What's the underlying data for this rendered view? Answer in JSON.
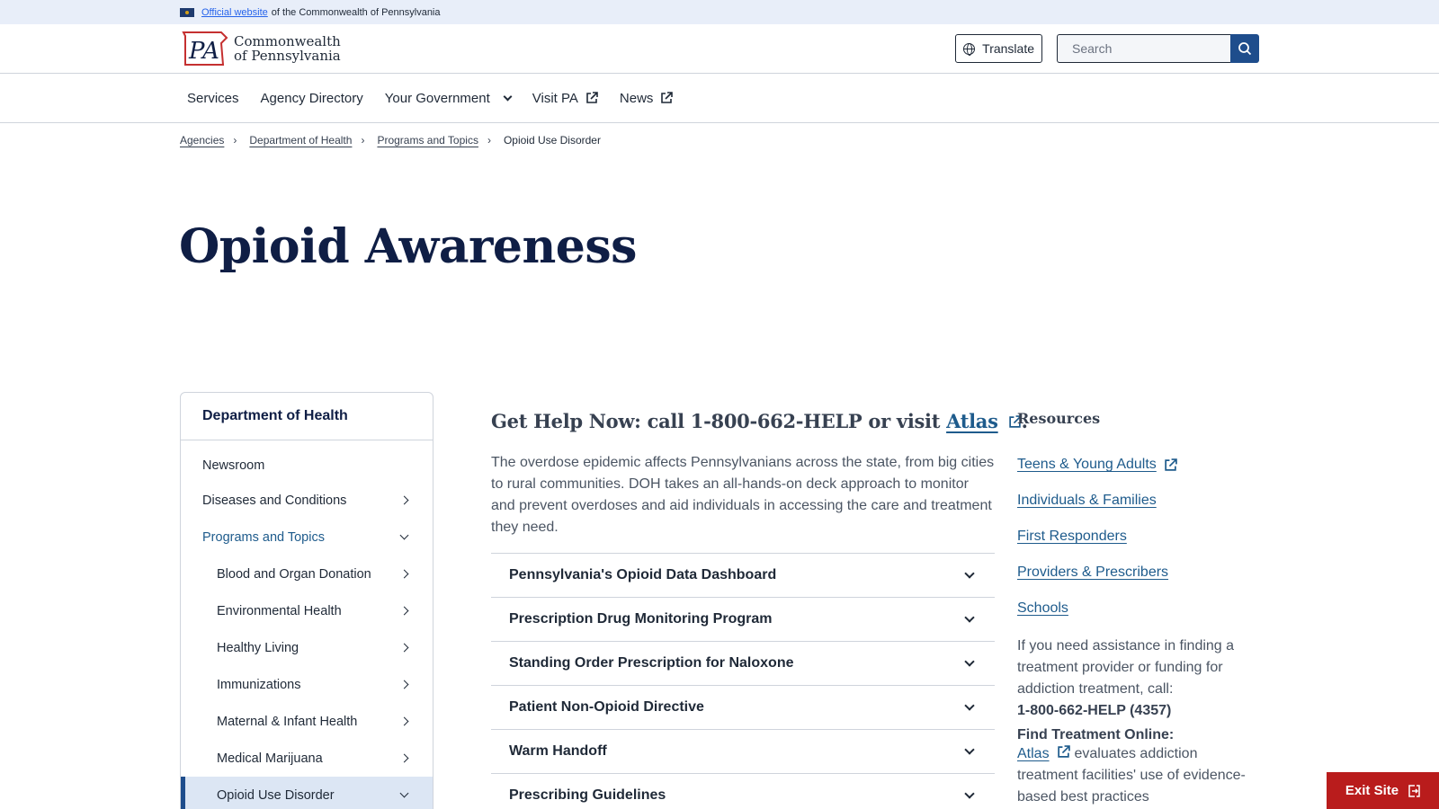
{
  "official_banner": {
    "link": "Official website",
    "rest": "of the Commonwealth of Pennsylvania"
  },
  "header": {
    "logo_line1": "Commonwealth",
    "logo_line2": "of Pennsylvania",
    "translate_label": "Translate",
    "search_placeholder": "Search"
  },
  "nav": {
    "items": [
      "Services",
      "Agency Directory",
      "Your Government",
      "Visit PA",
      "News"
    ]
  },
  "breadcrumb": {
    "items": [
      "Agencies",
      "Department of Health",
      "Programs and Topics"
    ],
    "current": "Opioid Use Disorder"
  },
  "page_title": "Opioid Awareness",
  "sidebar": {
    "heading": "Department of Health",
    "items": [
      "Newsroom",
      "Diseases and Conditions",
      "Programs and Topics",
      "Blood and Organ Donation",
      "Environmental Health",
      "Healthy Living",
      "Immunizations",
      "Maternal & Infant Health",
      "Medical Marijuana",
      "Opioid Use Disorder"
    ]
  },
  "main": {
    "get_help_prefix": "Get Help Now: call 1-800-662-HELP or visit ",
    "get_help_link": "Atlas",
    "get_help_suffix": ".",
    "intro": "The overdose epidemic affects Pennsylvanians across the state, from big cities to rural communities. DOH takes an all-hands-on deck approach to monitor and prevent overdoses and aid individuals in accessing the care and treatment they need.",
    "accordion": [
      "Pennsylvania's Opioid Data Dashboard",
      "Prescription Drug Monitoring Program",
      "Standing Order Prescription for Naloxone",
      "Patient Non-Opioid Directive",
      "Warm Handoff",
      "Prescribing Guidelines"
    ]
  },
  "resources": {
    "title": "Resources",
    "links": [
      "Teens & Young Adults",
      "Individuals & Families",
      "First Responders",
      "Providers & Prescribers",
      "Schools"
    ],
    "assist_text": "If you need assistance in finding a treatment provider or funding for addiction treatment, call:",
    "phone": "1-800-662-HELP (4357)",
    "find_heading": "Find Treatment Online:",
    "atlas_link": "Atlas",
    "atlas_text": " evaluates addiction treatment facilities' use of evidence-based best practices"
  },
  "exit_button": "Exit Site",
  "colors": {
    "navy": "#0f1e45",
    "link_blue": "#1e5b8c",
    "exit_red": "#b91c1c",
    "banner_bg": "#e8eef9"
  }
}
